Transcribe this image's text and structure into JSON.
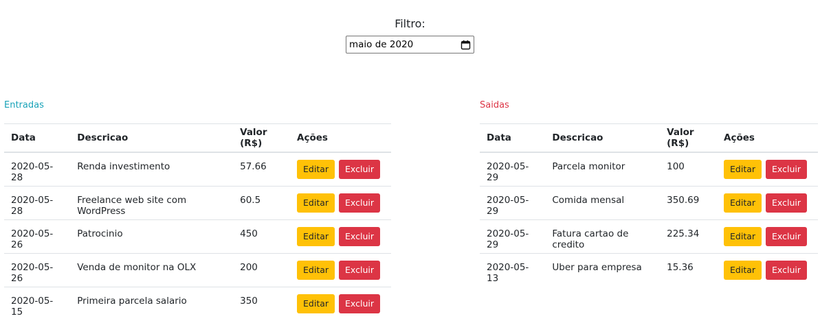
{
  "filter": {
    "label": "Filtro:",
    "value": "maio de 2020"
  },
  "entradas": {
    "title": "Entradas",
    "headers": [
      "Data",
      "Descricao",
      "Valor (R$)",
      "Ações"
    ],
    "rows": [
      {
        "date": "2020-05-28",
        "desc": "Renda investimento",
        "value": "57.66"
      },
      {
        "date": "2020-05-28",
        "desc": "Freelance web site com WordPress",
        "value": "60.5"
      },
      {
        "date": "2020-05-26",
        "desc": "Patrocinio",
        "value": "450"
      },
      {
        "date": "2020-05-26",
        "desc": "Venda de monitor na OLX",
        "value": "200"
      },
      {
        "date": "2020-05-15",
        "desc": "Primeira parcela salario",
        "value": "350"
      }
    ]
  },
  "saidas": {
    "title": "Saidas",
    "headers": [
      "Data",
      "Descricao",
      "Valor (R$)",
      "Ações"
    ],
    "rows": [
      {
        "date": "2020-05-29",
        "desc": "Parcela monitor",
        "value": "100"
      },
      {
        "date": "2020-05-29",
        "desc": "Comida mensal",
        "value": "350.69"
      },
      {
        "date": "2020-05-29",
        "desc": "Fatura cartao de credito",
        "value": "225.34"
      },
      {
        "date": "2020-05-13",
        "desc": "Uber para empresa",
        "value": "15.36"
      }
    ]
  },
  "actions": {
    "edit_label": "Editar",
    "delete_label": "Excluir"
  },
  "colors": {
    "entradas_title": "#17a2b8",
    "saidas_title": "#dc3545",
    "edit_button": "#ffc107",
    "delete_button": "#dc3545"
  }
}
